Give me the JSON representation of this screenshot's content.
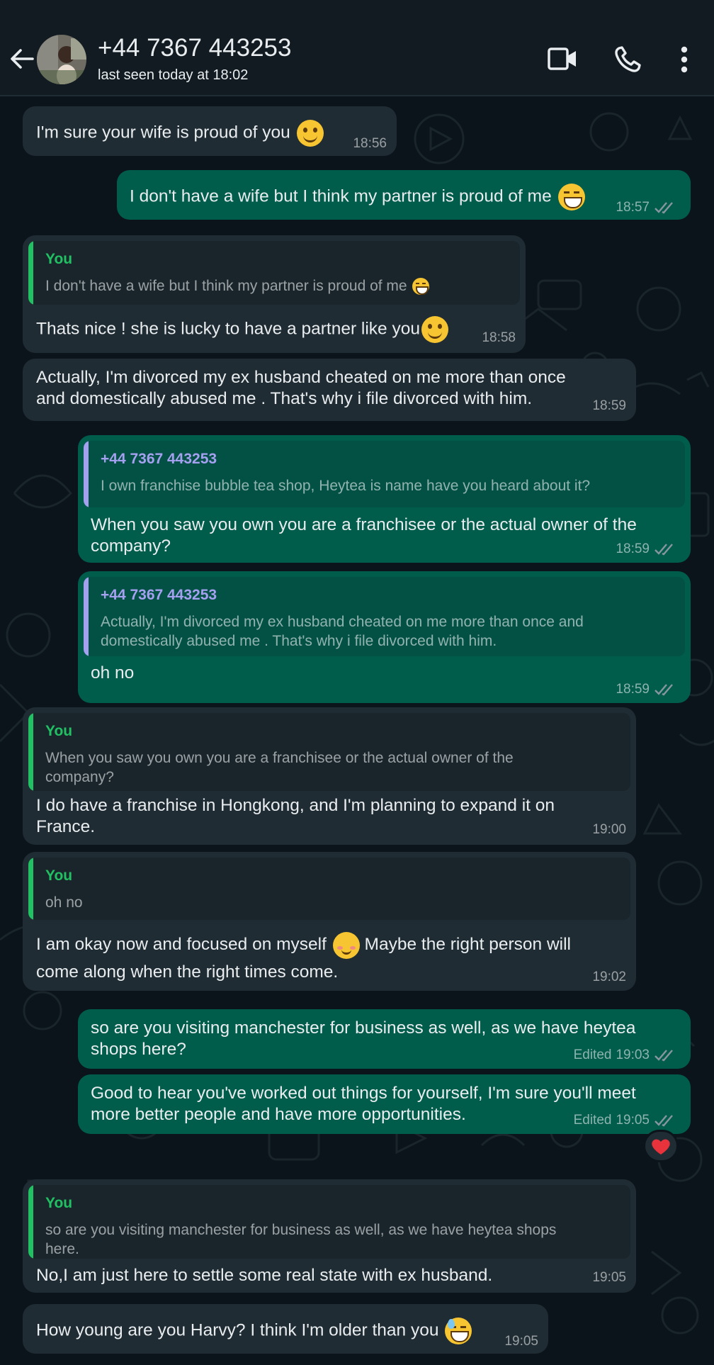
{
  "header": {
    "contact_name": "+44 7367 443253",
    "status": "last seen today at 18:02",
    "icons": [
      "back-arrow-icon",
      "video-call-icon",
      "phone-icon",
      "more-vert-icon"
    ]
  },
  "colors": {
    "background": "#0b141a",
    "header_bg": "#111b21",
    "incoming_bubble": "#202c33",
    "outgoing_bubble": "#005c4b",
    "quote_you": "#21c063",
    "quote_contact": "#a5a1f0",
    "read_ticks": "#8696a0"
  },
  "messages": [
    {
      "dir": "in",
      "text": "I'm sure your wife is proud of you",
      "emoji": "smile",
      "time": "18:56"
    },
    {
      "dir": "out",
      "text": "I don't have a wife but I think my partner is proud of me",
      "emoji": "laugh",
      "time": "18:57"
    },
    {
      "dir": "in",
      "quote_name": "You",
      "quote_text": "I don't have a wife but I think my partner is proud of me",
      "text": "Thats nice ! she is lucky to have a partner like you",
      "emoji": "smile",
      "time": "18:58"
    },
    {
      "dir": "in",
      "text_lines": [
        "Actually, I'm divorced my ex husband cheated on me more than once",
        "and domestically abused me . That's why i file divorced with him."
      ],
      "time": "18:59"
    },
    {
      "dir": "out",
      "quote_name": "+44 7367 443253",
      "quote_text": "I own franchise bubble tea shop, Heytea is name have you heard about it?",
      "text_lines": [
        "When you saw you own you are a franchisee or the actual owner of the",
        "company?"
      ],
      "time": "18:59"
    },
    {
      "dir": "out",
      "quote_name": "+44 7367 443253",
      "quote_lines": [
        "Actually, I'm divorced my ex husband cheated on me more than once and",
        "domestically abused me . That's why i file divorced with him."
      ],
      "text": "oh no",
      "time": "18:59"
    },
    {
      "dir": "in",
      "quote_name": "You",
      "quote_lines": [
        "When you saw you own you are a franchisee or the actual owner of the",
        "company?"
      ],
      "text_lines": [
        "I do have a franchise in Hongkong, and I'm planning to expand it on",
        "France."
      ],
      "time": "19:00"
    },
    {
      "dir": "in",
      "quote_name": "You",
      "quote_text": "oh no",
      "text_a": "I am okay now and focused on myself",
      "emoji": "blush",
      "text_b": "Maybe the right person will",
      "text_c": "come along when the right times come.",
      "time": "19:02"
    },
    {
      "dir": "out",
      "text_lines": [
        "so are you visiting manchester for business as well, as we have heytea",
        "shops here?"
      ],
      "edited": "Edited",
      "time": "19:03"
    },
    {
      "dir": "out",
      "text_lines": [
        "Good to hear you've worked out things for yourself, I'm sure you'll meet",
        "more better people and have more opportunities."
      ],
      "edited": "Edited",
      "time": "19:05",
      "reaction": "heart-emoji"
    },
    {
      "dir": "in",
      "quote_name": "You",
      "quote_lines": [
        "so are you visiting manchester for business as well, as we have heytea shops",
        "here."
      ],
      "text": "No,I am just here to settle some real state with ex husband.",
      "time": "19:05"
    },
    {
      "dir": "in",
      "text": "How young are you Harvy? I think I'm older than you",
      "emoji": "sweat",
      "time": "19:05"
    }
  ]
}
